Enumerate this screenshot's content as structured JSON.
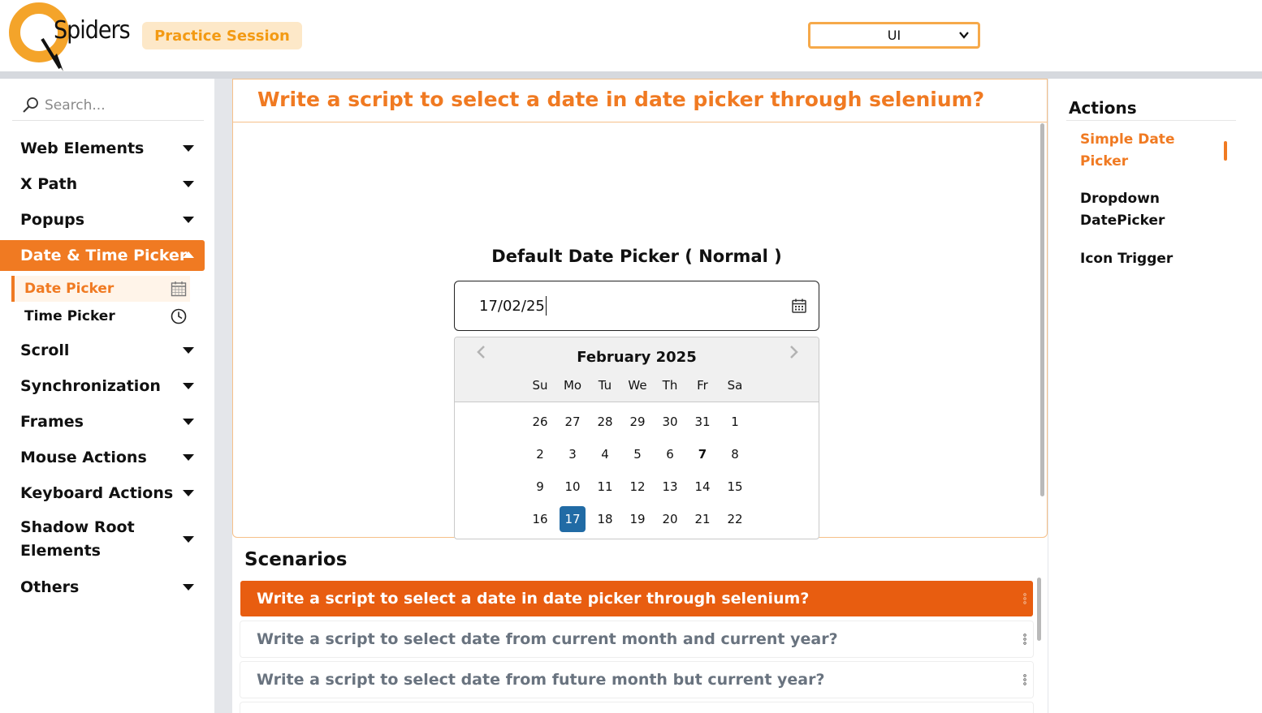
{
  "header": {
    "logo_text": "Spiders",
    "badge": "Practice Session",
    "select_value": "UI"
  },
  "sidebar": {
    "search_placeholder": "Search...",
    "items": [
      {
        "label": "Web Elements"
      },
      {
        "label": "X Path"
      },
      {
        "label": "Popups"
      },
      {
        "label": "Date & Time Picker"
      },
      {
        "label": "Scroll"
      },
      {
        "label": "Synchronization"
      },
      {
        "label": "Frames"
      },
      {
        "label": "Mouse Actions"
      },
      {
        "label": "Keyboard Actions"
      },
      {
        "label": "Shadow Root Elements"
      },
      {
        "label": "Others"
      }
    ],
    "subitems": [
      {
        "label": "Date Picker",
        "icon": "calendar-icon"
      },
      {
        "label": "Time Picker",
        "icon": "clock-icon"
      }
    ]
  },
  "main": {
    "question": "Write a script to select a date in date picker through selenium?",
    "picker_heading": "Default Date Picker ( Normal )",
    "input_value": "17/02/25",
    "calendar": {
      "month": "February 2025",
      "dows": [
        "Su",
        "Mo",
        "Tu",
        "We",
        "Th",
        "Fr",
        "Sa"
      ],
      "weeks": [
        [
          "26",
          "27",
          "28",
          "29",
          "30",
          "31",
          "1"
        ],
        [
          "2",
          "3",
          "4",
          "5",
          "6",
          "7",
          "8"
        ],
        [
          "9",
          "10",
          "11",
          "12",
          "13",
          "14",
          "15"
        ],
        [
          "16",
          "17",
          "18",
          "19",
          "20",
          "21",
          "22"
        ]
      ],
      "selected_day": "17",
      "bold_day": "7"
    }
  },
  "scenarios": {
    "title": "Scenarios",
    "items": [
      "Write a script to select a date in date picker through selenium?",
      "Write a script to select date from current month and current year?",
      "Write a script to select date from future month but current year?"
    ]
  },
  "actions": {
    "title": "Actions",
    "links": [
      {
        "label": "Simple Date Picker"
      },
      {
        "label": "Dropdown DatePicker"
      },
      {
        "label": "Icon Trigger"
      }
    ]
  },
  "colors": {
    "accent": "#f07a22",
    "scenario_active": "#e85d10",
    "selected_day": "#216ba5",
    "badge_bg": "#fde8c8"
  }
}
